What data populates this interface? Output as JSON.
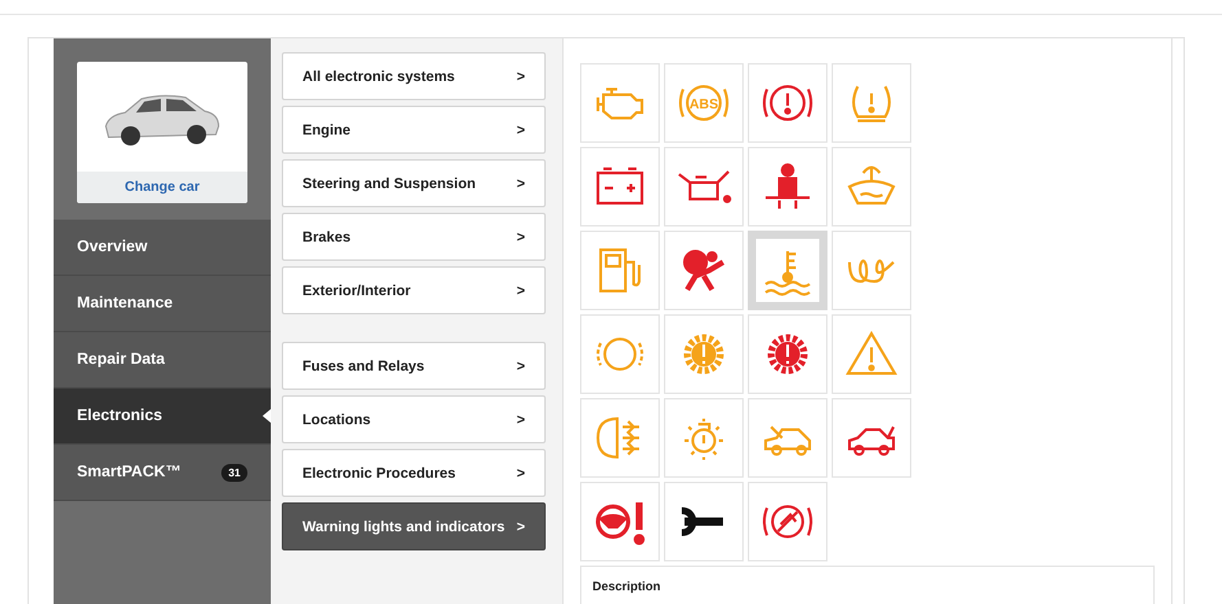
{
  "car_card": {
    "link": "Change car"
  },
  "sidebar": {
    "items": [
      {
        "label": "Overview",
        "selected": false
      },
      {
        "label": "Maintenance",
        "selected": false
      },
      {
        "label": "Repair Data",
        "selected": false
      },
      {
        "label": "Electronics",
        "selected": true
      },
      {
        "label": "SmartPACK™",
        "selected": false,
        "badge": "31"
      }
    ]
  },
  "menu_groups": [
    [
      {
        "label": "All electronic systems",
        "selected": false
      },
      {
        "label": "Engine",
        "selected": false
      },
      {
        "label": "Steering and Suspension",
        "selected": false
      },
      {
        "label": "Brakes",
        "selected": false
      },
      {
        "label": "Exterior/Interior",
        "selected": false
      }
    ],
    [
      {
        "label": "Fuses and Relays",
        "selected": false
      },
      {
        "label": "Locations",
        "selected": false
      },
      {
        "label": "Electronic Procedures",
        "selected": false
      },
      {
        "label": "Warning lights and indicators",
        "selected": true
      }
    ]
  ],
  "menu_chevron": ">",
  "warning_lights": [
    {
      "kind": "engine",
      "color": "#f5a31a",
      "selected": false
    },
    {
      "kind": "abs",
      "color": "#f5a31a",
      "selected": false,
      "label": "ABS"
    },
    {
      "kind": "brake",
      "color": "#e3202a",
      "selected": false
    },
    {
      "kind": "tire",
      "color": "#f5a31a",
      "selected": false
    },
    {
      "kind": "battery",
      "color": "#e3202a",
      "selected": false
    },
    {
      "kind": "oil",
      "color": "#e3202a",
      "selected": false
    },
    {
      "kind": "seatbelt",
      "color": "#e3202a",
      "selected": false
    },
    {
      "kind": "washer",
      "color": "#f5a31a",
      "selected": false
    },
    {
      "kind": "fuel",
      "color": "#f5a31a",
      "selected": false
    },
    {
      "kind": "airbag",
      "color": "#e3202a",
      "selected": false
    },
    {
      "kind": "coolant",
      "color": "#f5a31a",
      "selected": true
    },
    {
      "kind": "glow",
      "color": "#f5a31a",
      "selected": false
    },
    {
      "kind": "pads",
      "color": "#f5a31a",
      "selected": false
    },
    {
      "kind": "gear",
      "color": "#f5a31a",
      "selected": false
    },
    {
      "kind": "gear",
      "color": "#e3202a",
      "selected": false
    },
    {
      "kind": "triangle",
      "color": "#f5a31a",
      "selected": false
    },
    {
      "kind": "fog",
      "color": "#f5a31a",
      "selected": false
    },
    {
      "kind": "bulb",
      "color": "#f5a31a",
      "selected": false
    },
    {
      "kind": "hood",
      "color": "#f5a31a",
      "selected": false
    },
    {
      "kind": "trunk",
      "color": "#e3202a",
      "selected": false
    },
    {
      "kind": "steering",
      "color": "#e3202a",
      "selected": false
    },
    {
      "kind": "wrench",
      "color": "#111111",
      "selected": false
    },
    {
      "kind": "parking",
      "color": "#e3202a",
      "selected": false
    }
  ],
  "description": {
    "heading": "Description"
  }
}
